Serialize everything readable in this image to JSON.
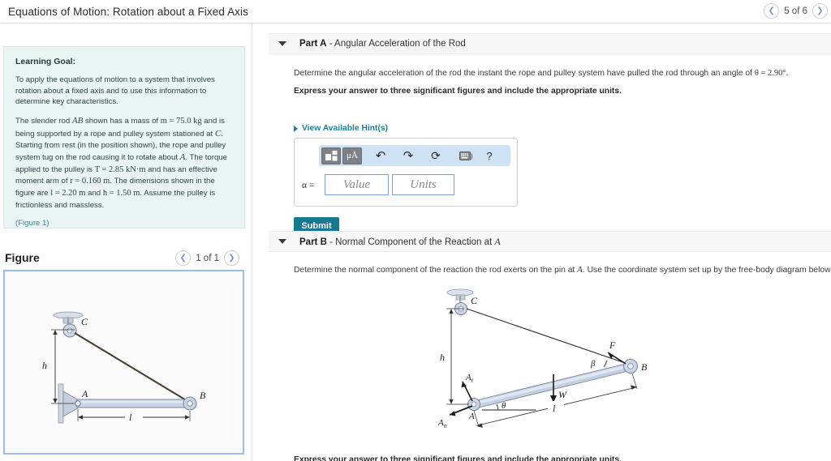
{
  "topbar": {
    "title": "Equations of Motion: Rotation about a Fixed Axis",
    "prev_icon": "chevron-left-icon",
    "next_icon": "chevron-right-icon",
    "page_label": "5 of 6"
  },
  "left_panel": {
    "learning_goal": {
      "heading": "Learning Goal:",
      "para1": "To apply the equations of motion to a system that involves rotation about a fixed axis and to use this information to determine key characteristics.",
      "para2_a": "The slender rod ",
      "para2_ab": "AB",
      "para2_b": " shown has a mass of ",
      "para2_m": "m = 75.0 kg",
      "para2_c": " and is being supported by a rope and pulley system stationed at ",
      "para2_C": "C",
      "para2_d": ". Starting from rest (in the position shown), the rope and pulley system tug on the rod causing it to rotate about ",
      "para2_A": "A",
      "para2_e": ". The torque applied to the pulley is ",
      "para2_T": "T = 2.85 kN·m",
      "para2_f": " and has an effective moment arm of ",
      "para2_r": "r = 0.160 m",
      "para2_g": ". The dimensions shown in the figure are ",
      "para2_l": "l = 2.20 m",
      "para2_h": " and ",
      "para2_hh": "h = 1.50 m",
      "para2_i": ". Assume the pulley is frictionless and massless.",
      "figure_link": "(Figure 1)"
    },
    "figure": {
      "title": "Figure",
      "prev_icon": "chevron-left-icon",
      "next_icon": "chevron-right-icon",
      "page_label": "1 of 1",
      "labels": {
        "C": "C",
        "A": "A",
        "B": "B",
        "h": "h",
        "l": "l"
      }
    }
  },
  "parts": {
    "part_a": {
      "caret_icon": "caret-down-icon",
      "label": "Part A",
      "dash": " - ",
      "subtitle": "Angular Acceleration of the Rod",
      "question_a": "Determine the angular acceleration of the rod the instant the rope and pulley system have pulled the rod through an angle of ",
      "question_theta": "θ = 2.90°",
      "question_b": ".",
      "instruction": "Express your answer to three significant figures and include the appropriate units.",
      "hints_label": "View Available Hint(s)",
      "hints_caret_icon": "caret-right-icon",
      "toolbar": {
        "template_icon": "math-template-icon",
        "units_icon": "micro-angstrom-units-icon",
        "undo_icon": "undo-arrow-icon",
        "redo_icon": "redo-arrow-icon",
        "reset_icon": "reset-circular-arrow-icon",
        "keyboard_icon": "keyboard-icon",
        "keyboard_glyph": "⌨",
        "keyboard_suffix": ")",
        "help_icon": "question-mark-help-icon",
        "help_glyph": "?",
        "units_glyph": "μÅ",
        "undo_glyph": "↶",
        "redo_glyph": "↷",
        "reset_glyph": "⟳"
      },
      "answer": {
        "symbol": "α =",
        "value_placeholder": "Value",
        "units_placeholder": "Units",
        "value": "",
        "units": ""
      },
      "submit_label": "Submit"
    },
    "part_b": {
      "caret_icon": "caret-down-icon",
      "label": "Part B",
      "dash": " - ",
      "subtitle_a": "Normal Component of the Reaction at ",
      "subtitle_A": "A",
      "question_a": "Determine the normal component of the reaction the rod exerts on the pin at ",
      "question_A": "A",
      "question_b": ". Use the coordinate system set up by the free-body diagram below.",
      "instruction": "Express your answer to three significant figures and include the appropriate units.",
      "fbd_labels": {
        "C": "C",
        "A": "A",
        "B": "B",
        "F": "F",
        "W": "W",
        "h": "h",
        "l": "l",
        "theta": "θ",
        "beta": "β",
        "At": "A",
        "At_sub": "t",
        "An": "A",
        "An_sub": "n"
      }
    }
  },
  "colors": {
    "accent_teal": "#18788f",
    "link_teal": "#1a7fa0",
    "goal_bg": "#e9f4f3",
    "toolbar_blue": "#cfe2f5",
    "figure_border": "#9dbdf2",
    "rod_fill": "#c8d4e4"
  }
}
